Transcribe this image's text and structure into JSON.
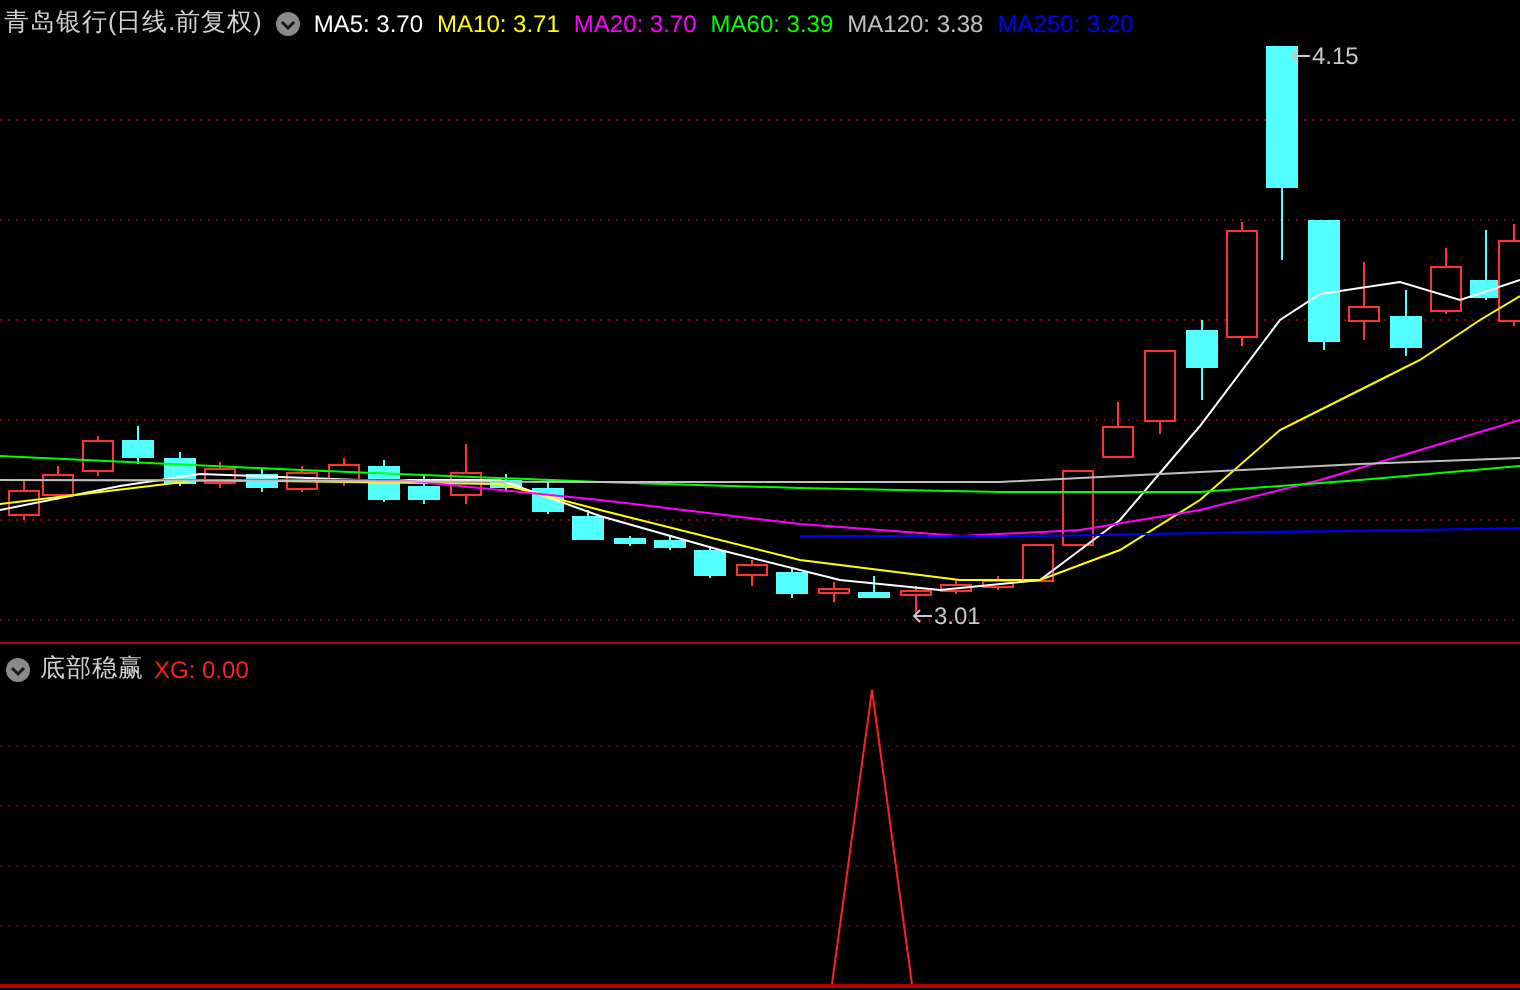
{
  "header": {
    "title": "青岛银行(日线.前复权)",
    "moving_averages": [
      {
        "label": "MA5: 3.70",
        "color": "#ffffff"
      },
      {
        "label": "MA10: 3.71",
        "color": "#ffff00"
      },
      {
        "label": "MA20: 3.70",
        "color": "#ff00ff"
      },
      {
        "label": "MA60: 3.39",
        "color": "#00ff00"
      },
      {
        "label": "MA120: 3.38",
        "color": "#c0c0c0"
      },
      {
        "label": "MA250: 3.20",
        "color": "#0000ff"
      }
    ]
  },
  "annotations": [
    {
      "kind": "high",
      "text": "4.15"
    },
    {
      "kind": "low",
      "text": "3.01"
    }
  ],
  "indicator": {
    "name": "底部稳赢",
    "reading": "XG: 0.00"
  }
}
